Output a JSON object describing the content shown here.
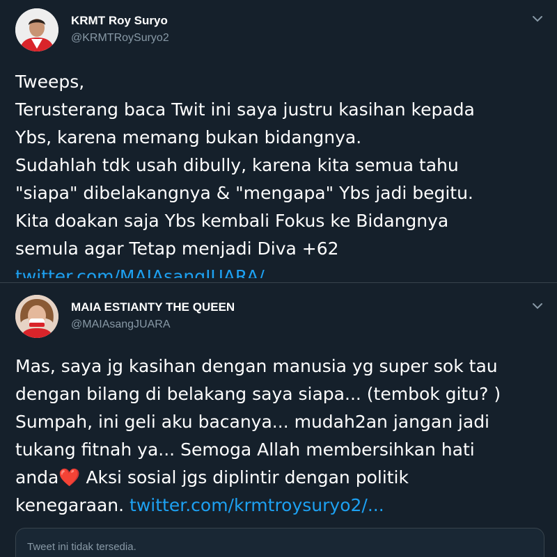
{
  "tweets": [
    {
      "author_name": "KRMT Roy Suryo",
      "author_handle": "@KRMTRoySuryo2",
      "avatar_icon": "profile-photo",
      "lines": [
        "Tweeps,",
        "Terusterang baca Twit ini saya justru kasihan kepada",
        "Ybs, karena memang bukan bidangnya.",
        "Sudahlah tdk usah dibully, karena kita semua tahu",
        "\"siapa\" dibelakangnya & \"mengapa\" Ybs jadi begitu.",
        "Kita doakan saja Ybs kembali Fokus ke Bidangnya",
        "semula agar Tetap menjadi Diva +62"
      ],
      "link": "twitter.com/MAIAsangJUARA/..."
    },
    {
      "author_name": "MAIA ESTIANTY THE QUEEN",
      "author_handle": "@MAIAsangJUARA",
      "avatar_icon": "profile-photo",
      "lines": [
        "Mas, saya jg kasihan dengan manusia yg super sok tau",
        "dengan bilang di belakang saya siapa... (tembok gitu? )",
        "Sumpah, ini geli aku bacanya... mudah2an jangan jadi",
        "tukang fitnah ya... Semoga Allah membersihkan hati"
      ],
      "line5_before": "anda",
      "heart_emoji": "❤️",
      "line5_after": " Aksi sosial jgs diplintir dengan politik",
      "line6_text": "kenegaraan. ",
      "link": "twitter.com/krmtroysuryo2/...",
      "quoted_card_text": "Tweet ini tidak tersedia."
    }
  ],
  "colors": {
    "background": "#15202b",
    "text": "#ffffff",
    "secondary": "#8899a6",
    "link": "#1da1f2",
    "border": "#38444d"
  }
}
